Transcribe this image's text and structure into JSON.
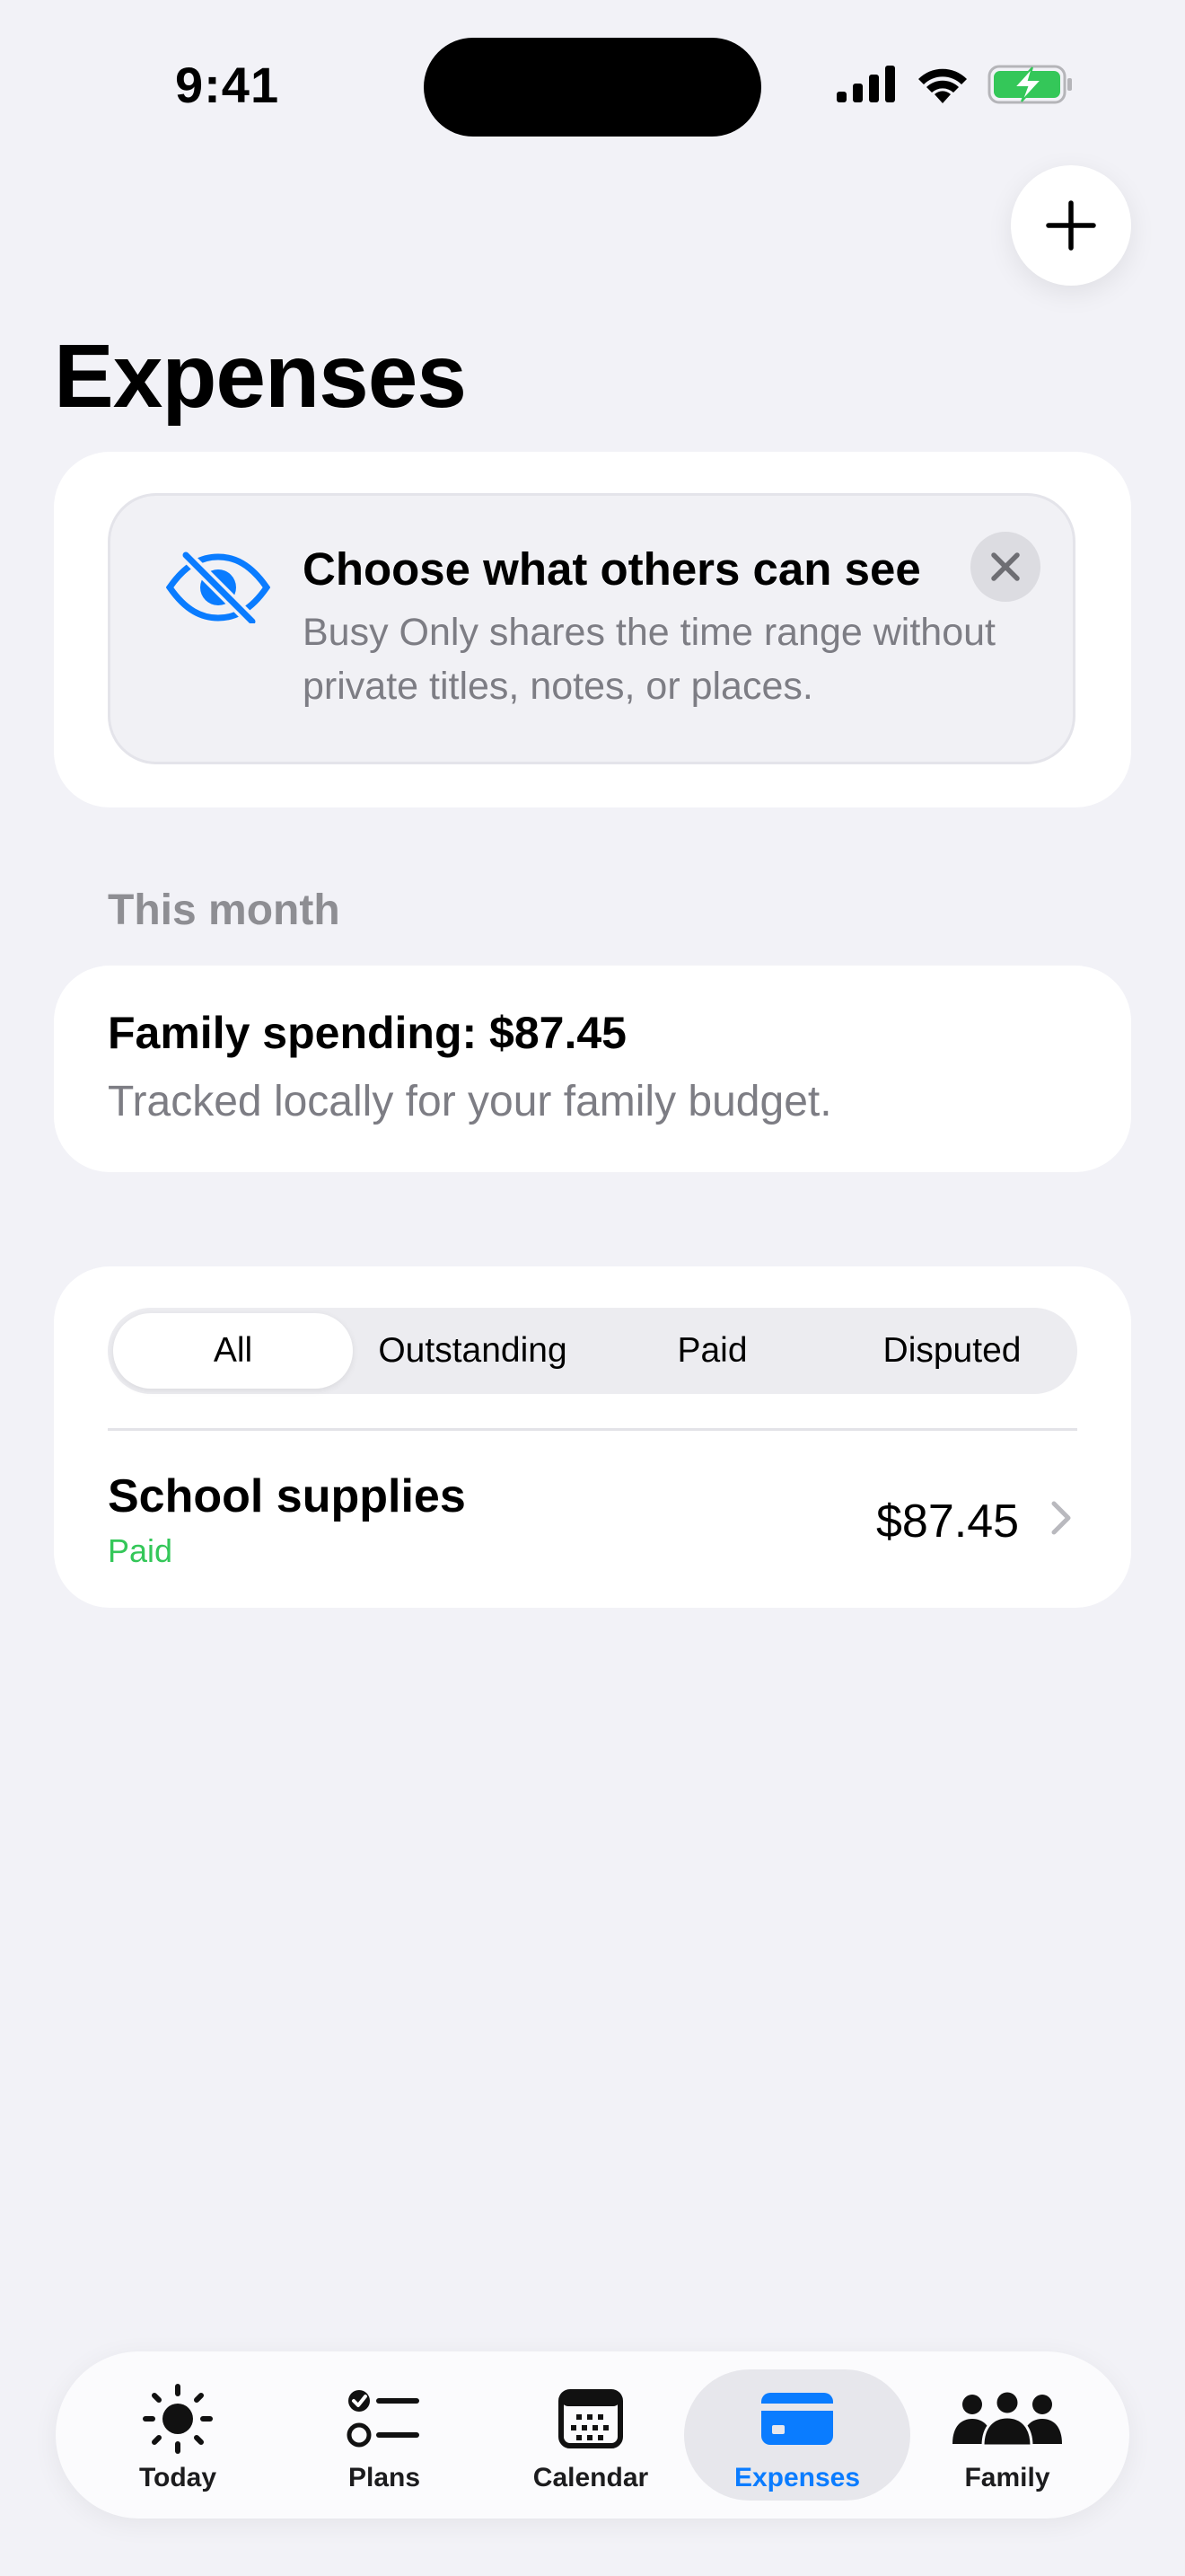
{
  "status_bar": {
    "time": "9:41"
  },
  "header": {
    "title": "Expenses",
    "add_icon": "plus-icon"
  },
  "privacy_card": {
    "icon": "eye-slash-icon",
    "title": "Choose what others can see",
    "text": "Busy Only shares the time range without private titles, notes, or places.",
    "close_icon": "close-icon"
  },
  "section_label": "This month",
  "summary": {
    "title": "Family spending: $87.45",
    "subtitle": "Tracked locally for your family budget."
  },
  "filters": {
    "options": [
      "All",
      "Outstanding",
      "Paid",
      "Disputed"
    ],
    "selected": "All"
  },
  "expenses": [
    {
      "title": "School supplies",
      "status": "Paid",
      "amount": "$87.45"
    }
  ],
  "tabbar": {
    "items": [
      {
        "label": "Today",
        "icon": "sun-icon"
      },
      {
        "label": "Plans",
        "icon": "checklist-icon"
      },
      {
        "label": "Calendar",
        "icon": "calendar-icon"
      },
      {
        "label": "Expenses",
        "icon": "credit-card-icon",
        "active": true
      },
      {
        "label": "Family",
        "icon": "people-icon"
      }
    ]
  },
  "colors": {
    "accent": "#0a7cff",
    "paid": "#34c759",
    "background": "#f2f2f7"
  }
}
